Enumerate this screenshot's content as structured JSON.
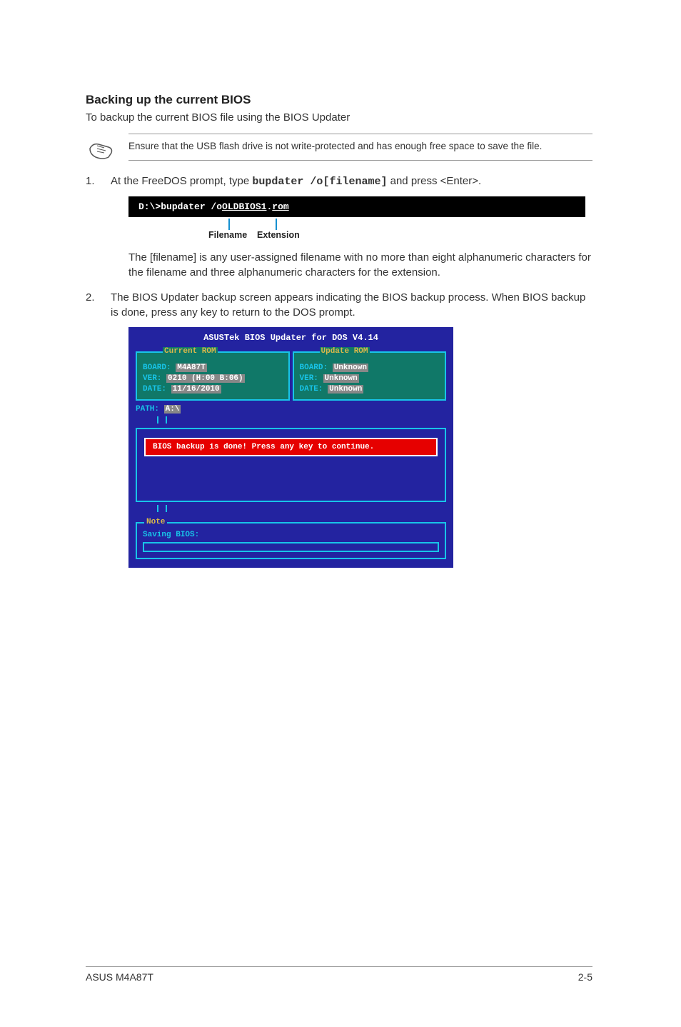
{
  "heading": "Backing up the current BIOS",
  "intro": "To backup the current BIOS file using the BIOS Updater",
  "note": "Ensure that the USB flash drive is not write-protected and has enough free space to save the file.",
  "step1": {
    "num": "1.",
    "pre": "At the FreeDOS prompt, type ",
    "cmd": "bupdater /o[filename]",
    "post": " and press <Enter>."
  },
  "terminal": {
    "prompt": "D:\\>",
    "text1": "bupdater /o",
    "file": "OLDBIOS1",
    "dot": ".",
    "ext": "rom"
  },
  "callouts": {
    "filename": "Filename",
    "extension": "Extension"
  },
  "sub1": "The [filename] is any user-assigned filename with no more than eight alphanumeric characters for the filename and three alphanumeric characters for the extension.",
  "step2": {
    "num": "2.",
    "text": "The BIOS Updater backup screen appears indicating the BIOS backup process. When BIOS backup is done, press any key to return to the DOS prompt."
  },
  "bios": {
    "title": "ASUSTek BIOS Updater for DOS V4.14",
    "current": {
      "legend": "Current ROM",
      "board_label": "BOARD:",
      "board": "M4A87T",
      "ver_label": "VER:",
      "ver": "0210 (H:00 B:06)",
      "date_label": "DATE:",
      "date": "11/16/2010"
    },
    "update": {
      "legend": "Update ROM",
      "board_label": "BOARD:",
      "board": "Unknown",
      "ver_label": "VER:",
      "ver": "Unknown",
      "date_label": "DATE:",
      "date": "Unknown"
    },
    "path_label": "PATH:",
    "path": "A:\\",
    "message": "BIOS backup is done! Press any key to continue.",
    "note_legend": "Note",
    "saving": "Saving BIOS:"
  },
  "footer": {
    "left": "ASUS M4A87T",
    "right": "2-5"
  }
}
